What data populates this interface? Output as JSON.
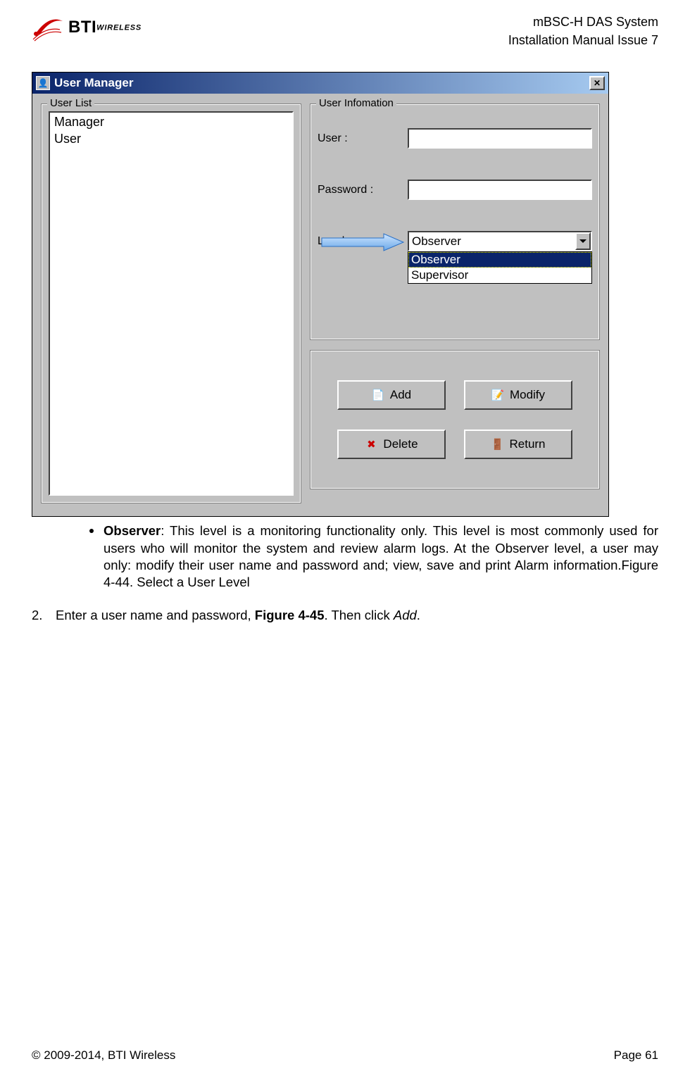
{
  "header": {
    "logo_b": "BTI",
    "logo_w": "WIRELESS",
    "line1": "mBSC-H DAS System",
    "line2": "Installation Manual Issue 7"
  },
  "dlg": {
    "title": "User Manager",
    "list_label": "User List",
    "list_items": [
      "Manager",
      "User"
    ],
    "info_label": "User Infomation",
    "user_label": "User :",
    "pass_label": "Password :",
    "level_label": "Level :",
    "level_selected": "Observer",
    "level_options": [
      "Observer",
      "Supervisor"
    ],
    "btn_add": "Add",
    "btn_modify": "Modify",
    "btn_delete": "Delete",
    "btn_return": "Return"
  },
  "body": {
    "bullet_bold": "Observer",
    "bullet_rest": ": This level is a monitoring functionality only. This level is most commonly used for users who will monitor the system and review alarm logs. At the Observer level, a user may only: modify their user name and password and; view, save and print Alarm information.Figure 4-44. Select a User Level",
    "step2_a": "Enter a user name and password, ",
    "step2_b": "Figure 4-45",
    "step2_c": ". Then click ",
    "step2_d": "Add",
    "step2_e": "."
  },
  "footer": {
    "left": "© 2009-2014, BTI Wireless",
    "right": "Page 61"
  }
}
